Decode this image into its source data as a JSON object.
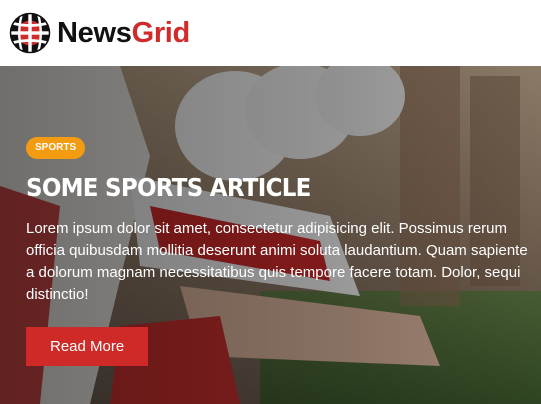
{
  "brand": {
    "name_part1": "News",
    "name_part2": "Grid",
    "icon": "globe-icon",
    "colors": {
      "dark": "#111111",
      "accent": "#d12a2a"
    }
  },
  "hero": {
    "background": "football-players-photo",
    "category": "SPORTS",
    "category_color": "#f39c12",
    "title": "SOME SPORTS ARTICLE",
    "excerpt": "Lorem ipsum dolor sit amet, consectetur adipisicing elit. Possimus rerum officia quibusdam mollitia deserunt animi soluta laudantium. Quam sapiente a dolorum magnam necessitatibus quis tempore facere totam. Dolor, sequi distinctio!",
    "read_more_label": "Read More",
    "button_color": "#cf2a27"
  }
}
